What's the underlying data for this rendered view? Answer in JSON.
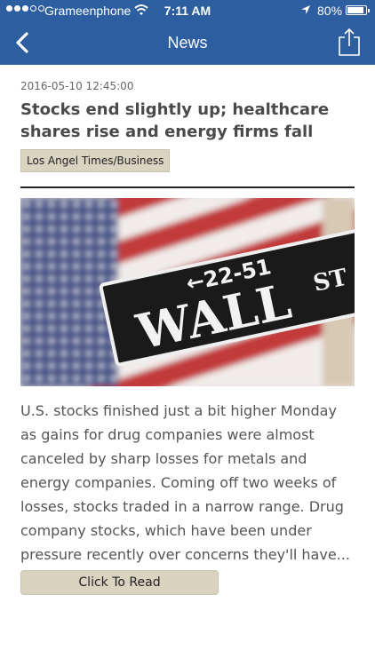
{
  "status_bar": {
    "carrier": "Grameenphone",
    "time": "7:11 AM",
    "battery": "80%",
    "battery_level": 0.8,
    "signal_bars_filled": 3,
    "signal_bars_total": 5
  },
  "nav": {
    "title": "News",
    "back_icon": "chevron-left-icon",
    "share_icon": "share-icon"
  },
  "article": {
    "timestamp": "2016-05-10 12:45:00",
    "headline": "Stocks end slightly up; healthcare shares rise and energy firms fall",
    "source": "Los Angel Times/Business",
    "image": {
      "sign_number": "←22-51",
      "sign_main": "WALL",
      "sign_suffix": "ST"
    },
    "summary": "U.S. stocks finished just a bit higher Monday as gains for drug companies were almost canceled by sharp losses for metals and energy companies. Coming off two weeks of losses, stocks traded in a narrow range. Drug company stocks, which have been under pressure recently over concerns they'll have...",
    "read_button": "Click To Read"
  },
  "colors": {
    "nav_bar": "#2d5fa0",
    "badge_bg": "#d8d4c0",
    "text_gray": "#555555",
    "headline": "#4a4a4a"
  }
}
